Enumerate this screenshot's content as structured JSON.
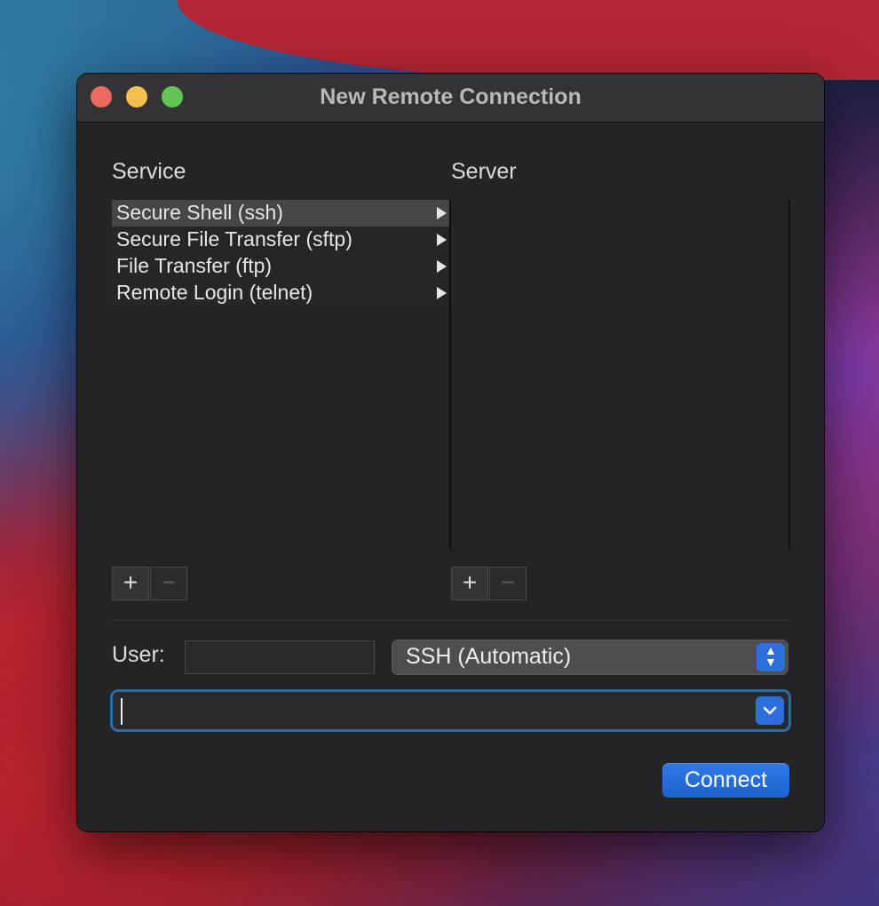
{
  "window": {
    "title": "New Remote Connection"
  },
  "service": {
    "heading": "Service",
    "items": [
      {
        "label": "Secure Shell (ssh)",
        "selected": true
      },
      {
        "label": "Secure File Transfer (sftp)",
        "selected": false
      },
      {
        "label": "File Transfer (ftp)",
        "selected": false
      },
      {
        "label": "Remote Login (telnet)",
        "selected": false
      }
    ],
    "add_label": "+",
    "remove_label": "−"
  },
  "server": {
    "heading": "Server",
    "items": [],
    "add_label": "+",
    "remove_label": "−"
  },
  "connection": {
    "user_label": "User:",
    "user_value": "",
    "protocol_value": "SSH (Automatic)",
    "host_value": "",
    "connect_label": "Connect"
  },
  "colors": {
    "accent": "#2d6fdc",
    "focus_ring": "#2d6a9e",
    "selected_row": "#46464a"
  }
}
